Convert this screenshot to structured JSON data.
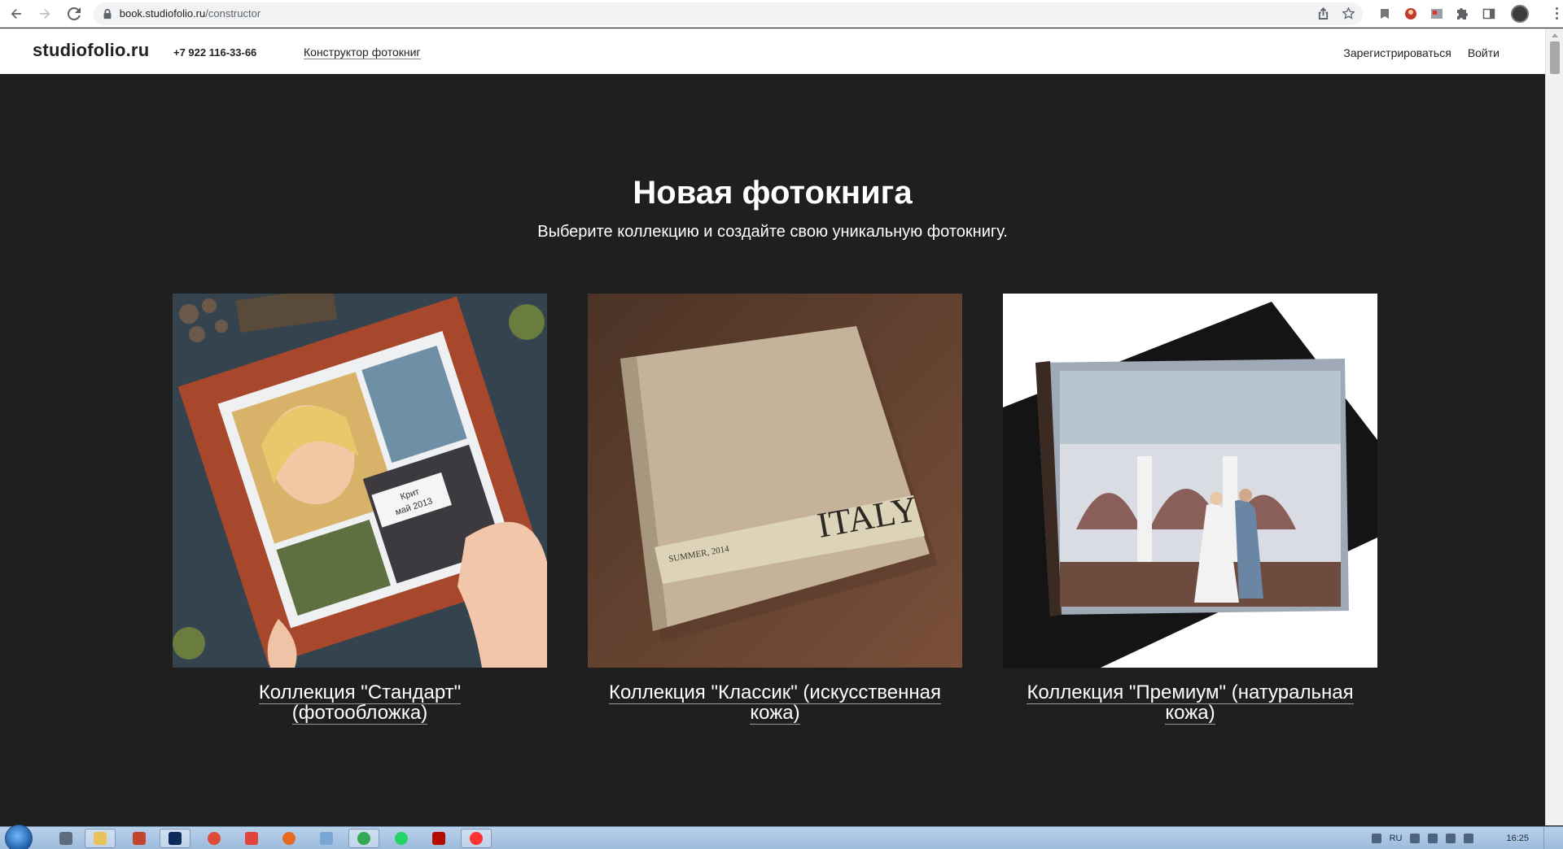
{
  "browser": {
    "url_host": "book.studiofolio.ru",
    "url_path": "/constructor"
  },
  "header": {
    "logo": "studiofolio.ru",
    "phone": "+7 922 116-33-66",
    "nav_link": "Конструктор фотокниг",
    "register": "Зарегистрироваться",
    "login": "Войти"
  },
  "main": {
    "title": "Новая фотокнига",
    "subtitle": "Выберите коллекцию и создайте свою уникальную фотокнигу.",
    "collections": [
      {
        "label": "Коллекция \"Стандарт\" (фотообложка)",
        "cover_text": "Крит\nмай 2013"
      },
      {
        "label": "Коллекция \"Классик\" (искусственная кожа)",
        "cover_title": "ITALY",
        "cover_subtitle": "SUMMER, 2014"
      },
      {
        "label": "Коллекция \"Премиум\" (натуральная кожа)"
      }
    ]
  },
  "taskbar": {
    "language": "RU",
    "time": "16:25"
  },
  "colors": {
    "page_background": "#1f1f1f",
    "header_background": "#ffffff",
    "text_light": "#ffffff",
    "text_dark": "#222222"
  }
}
